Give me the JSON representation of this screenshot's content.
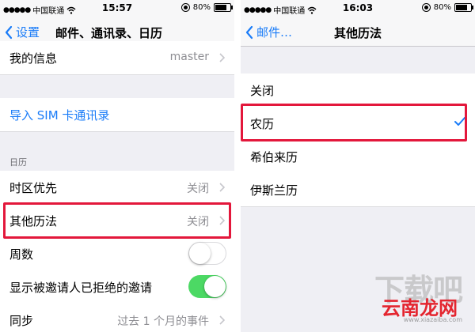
{
  "left_screen": {
    "status": {
      "carrier": "中国联通",
      "time": "15:57",
      "battery": "80%"
    },
    "nav": {
      "back_label": "设置",
      "title": "邮件、通讯录、日历"
    },
    "rows": {
      "my_info": {
        "label": "我的信息",
        "value": "master"
      },
      "import_sim": {
        "label": "导入 SIM 卡通讯录"
      },
      "calendar_header": "日历",
      "timezone": {
        "label": "时区优先",
        "value": "关闭"
      },
      "alt_calendar": {
        "label": "其他历法",
        "value": "关闭"
      },
      "week_numbers": {
        "label": "周数",
        "toggle": false
      },
      "declined": {
        "label": "显示被邀请人已拒绝的邀请",
        "toggle": true
      },
      "sync": {
        "label": "同步",
        "value": "过去 1 个月的事件"
      }
    }
  },
  "right_screen": {
    "status": {
      "carrier": "中国联通",
      "time": "16:03",
      "battery": "80%"
    },
    "nav": {
      "back_label": "邮件…",
      "title": "其他历法"
    },
    "options": [
      {
        "label": "关闭",
        "selected": false
      },
      {
        "label": "农历",
        "selected": true
      },
      {
        "label": "希伯来历",
        "selected": false
      },
      {
        "label": "伊斯兰历",
        "selected": false
      }
    ]
  },
  "watermark": {
    "brand_big": "下载吧",
    "brand_red": "云南龙网",
    "url": "www.xiazaiba.com"
  },
  "colors": {
    "accent": "#1a7cf8",
    "highlight": "#e3173b",
    "toggle_on": "#4cd964",
    "group_bg": "#efeff4"
  }
}
